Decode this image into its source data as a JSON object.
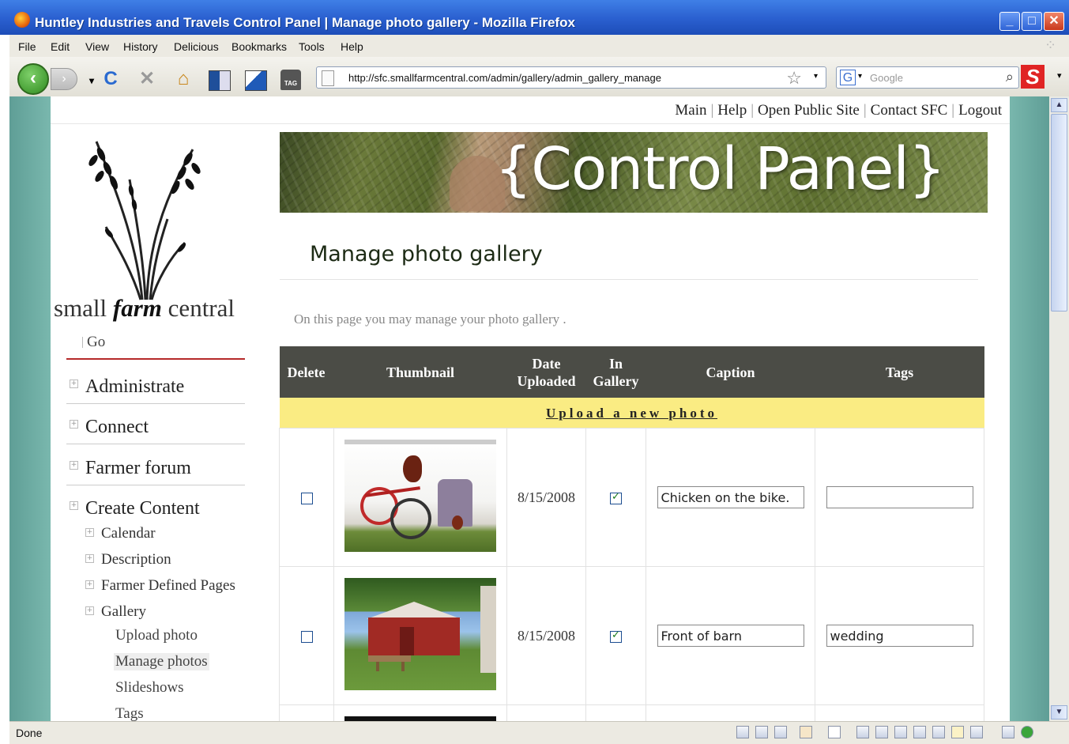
{
  "window": {
    "title": "Huntley Industries and Travels Control Panel | Manage photo gallery - Mozilla Firefox",
    "minimize": "_",
    "maximize": "□",
    "close": "✕"
  },
  "menu": [
    "File",
    "Edit",
    "View",
    "History",
    "Delicious",
    "Bookmarks",
    "Tools",
    "Help"
  ],
  "toolbar": {
    "url": "http://sfc.smallfarmcentral.com/admin/gallery/admin_gallery_manage",
    "search_placeholder": "Google",
    "search_engine": "G",
    "tag_label": "TAG"
  },
  "top_links": [
    "Main",
    "Help",
    "Open Public Site",
    "Contact SFC",
    "Logout"
  ],
  "logo": {
    "prefix": "small ",
    "bold": "farm",
    "suffix": " central"
  },
  "search_go": "Go",
  "sidebar": {
    "sections": [
      {
        "label": "Administrate"
      },
      {
        "label": "Connect"
      },
      {
        "label": "Farmer forum"
      },
      {
        "label": "Create Content"
      }
    ],
    "content_items": [
      "Calendar",
      "Description",
      "Farmer Defined Pages",
      "Gallery"
    ],
    "gallery_items": [
      "Upload photo",
      "Manage photos",
      "Slideshows",
      "Tags"
    ],
    "active_item": "Manage photos"
  },
  "banner": {
    "title": "{Control Panel}"
  },
  "page": {
    "heading": "Manage photo gallery",
    "intro": "On this page you may manage your photo gallery ."
  },
  "table": {
    "headers": {
      "delete": "Delete",
      "thumbnail": "Thumbnail",
      "date_1": "Date",
      "date_2": "Uploaded",
      "gallery_1": "In",
      "gallery_2": "Gallery",
      "caption": "Caption",
      "tags": "Tags"
    },
    "upload_link": "Upload a new photo",
    "rows": [
      {
        "delete": false,
        "image": "chicken-on-bike-photo",
        "date": "8/15/2008",
        "in_gallery": true,
        "caption": "Chicken on the bike.",
        "tags": ""
      },
      {
        "delete": false,
        "image": "red-barn-photo",
        "date": "8/15/2008",
        "in_gallery": true,
        "caption": "Front of barn",
        "tags": "wedding"
      }
    ]
  },
  "status": {
    "text": "Done"
  },
  "colors": {
    "titlebar": "#2a5fcf",
    "table_header": "#4b4c46",
    "upload_row": "#faec83",
    "nav_rule": "#b52a2a",
    "page_background": "#7ab8ae"
  }
}
